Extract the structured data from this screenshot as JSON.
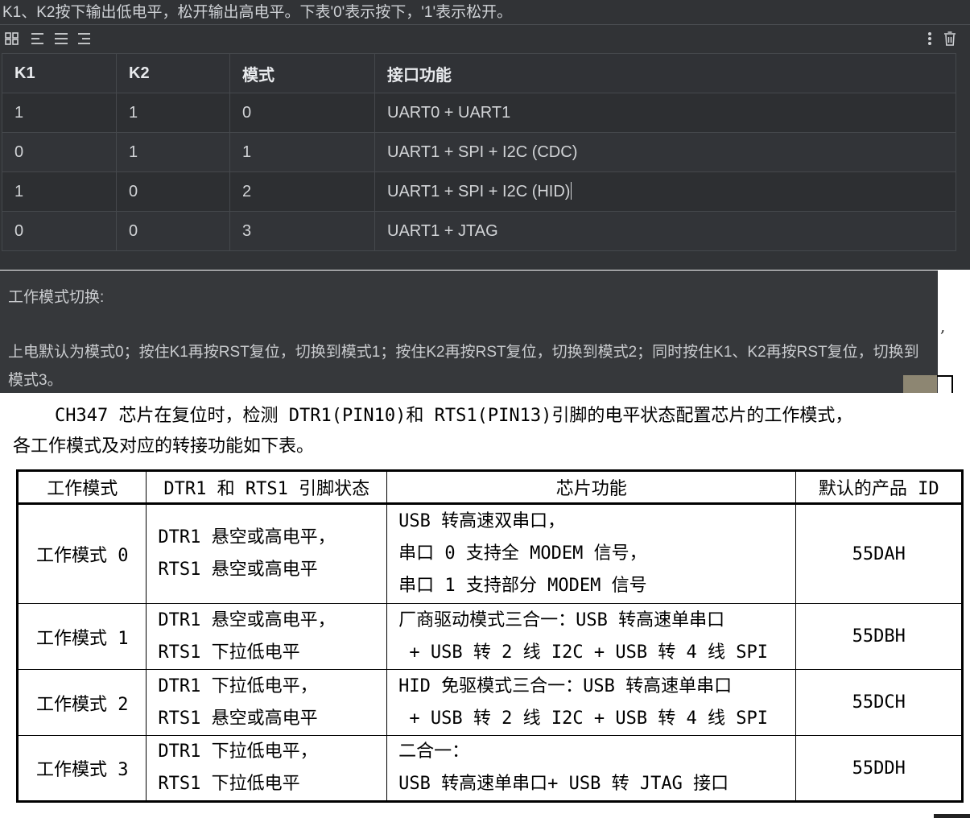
{
  "intro_text": "K1、K2按下输出低电平，松开输出高电平。下表'0'表示按下，'1'表示松开。",
  "toolbar": {
    "icons": [
      "grid-icon",
      "align-left-icon",
      "align-center-icon",
      "align-right-icon",
      "more-vertical-icon",
      "trash-icon"
    ]
  },
  "key_table": {
    "headers": [
      "K1",
      "K2",
      "模式",
      "接口功能"
    ],
    "rows": [
      [
        "1",
        "1",
        "0",
        "UART0 + UART1"
      ],
      [
        "0",
        "1",
        "1",
        "UART1 + SPI + I2C (CDC)"
      ],
      [
        "1",
        "0",
        "2",
        "UART1 + SPI + I2C (HID)"
      ],
      [
        "0",
        "0",
        "3",
        "UART1 + JTAG"
      ]
    ]
  },
  "mode_switch": {
    "title": "工作模式切换:",
    "description": "上电默认为模式0；按住K1再按RST复位，切换到模式1；按住K2再按RST复位，切换到模式2；同时按住K1、K2再按RST复位，切换到模式3。"
  },
  "stray_comma": ",",
  "doc": {
    "paragraph_line1": "CH347 芯片在复位时，检测 DTR1(PIN10)和 RTS1(PIN13)引脚的电平状态配置芯片的工作模式，",
    "paragraph_line2": "各工作模式及对应的转接功能如下表。",
    "table": {
      "headers": [
        "工作模式",
        "DTR1 和 RTS1 引脚状态",
        "芯片功能",
        "默认的产品 ID"
      ],
      "rows": [
        {
          "mode": "工作模式 0",
          "pins": [
            "DTR1 悬空或高电平，",
            "RTS1 悬空或高电平"
          ],
          "function": [
            "USB 转高速双串口，",
            "串口 0 支持全 MODEM 信号，",
            "串口 1 支持部分 MODEM 信号"
          ],
          "pid": "55DAH"
        },
        {
          "mode": "工作模式 1",
          "pins": [
            "DTR1 悬空或高电平，",
            "RTS1 下拉低电平"
          ],
          "function": [
            "厂商驱动模式三合一：USB 转高速单串口",
            " + USB 转 2 线 I2C + USB 转 4 线 SPI"
          ],
          "pid": "55DBH"
        },
        {
          "mode": "工作模式 2",
          "pins": [
            "DTR1 下拉低电平，",
            "RTS1 悬空或高电平"
          ],
          "function": [
            "HID 免驱模式三合一：USB 转高速单串口",
            " + USB 转 2 线 I2C + USB 转 4 线 SPI"
          ],
          "pid": "55DCH"
        },
        {
          "mode": "工作模式 3",
          "pins": [
            "DTR1 下拉低电平，",
            "RTS1 下拉低电平"
          ],
          "function": [
            "二合一：",
            "USB 转高速单串口+ USB 转 JTAG 接口"
          ],
          "pid": "55DDH"
        }
      ]
    }
  }
}
